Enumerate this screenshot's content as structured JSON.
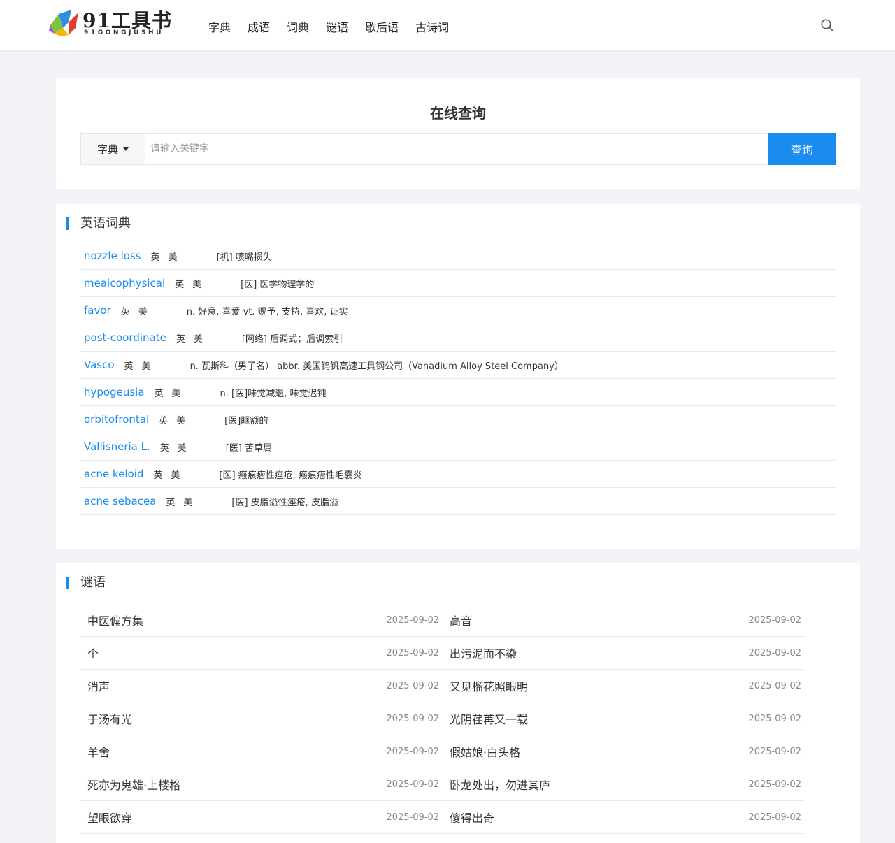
{
  "brand": {
    "logo_text": "91工具书",
    "logo_sub": "91GONGJUSHU"
  },
  "nav": [
    {
      "label": "字典"
    },
    {
      "label": "成语"
    },
    {
      "label": "词典"
    },
    {
      "label": "谜语"
    },
    {
      "label": "歇后语"
    },
    {
      "label": "古诗词"
    }
  ],
  "search": {
    "title": "在线查询",
    "select_value": "字典",
    "placeholder": "请输入关键字",
    "button": "查询"
  },
  "dict": {
    "title": "英语词典",
    "items": [
      {
        "word": "nozzle loss",
        "uk": "英",
        "us": "美",
        "meaning": "[机] 喷嘴损失"
      },
      {
        "word": "meaicophysical",
        "uk": "英",
        "us": "美",
        "meaning": "[医] 医学物理学的"
      },
      {
        "word": "favor",
        "uk": "英",
        "us": "美",
        "meaning": "n. 好意, 喜爱 vt. 赐予, 支持, 喜欢, 证实"
      },
      {
        "word": "post-coordinate",
        "uk": "英",
        "us": "美",
        "meaning": "[网络] 后调式；后调索引"
      },
      {
        "word": "Vasco",
        "uk": "英",
        "us": "美",
        "meaning": "n. 瓦斯科（男子名） abbr. 美国钨钒高速工具钢公司（Vanadium Alloy Steel Company）"
      },
      {
        "word": "hypogeusia",
        "uk": "英",
        "us": "美",
        "meaning": "n. [医]味觉减退, 味觉迟钝"
      },
      {
        "word": "orbitofrontal",
        "uk": "英",
        "us": "美",
        "meaning": "[医]眶额的"
      },
      {
        "word": "Vallisneria L.",
        "uk": "英",
        "us": "美",
        "meaning": "[医] 苦草属"
      },
      {
        "word": "acne keloid",
        "uk": "英",
        "us": "美",
        "meaning": "[医] 瘢痕瘤性痤疮, 瘢痕瘤性毛囊炎"
      },
      {
        "word": "acne sebacea",
        "uk": "英",
        "us": "美",
        "meaning": "[医] 皮脂溢性痤疮, 皮脂溢"
      }
    ]
  },
  "riddles": {
    "title": "谜语",
    "items": [
      {
        "title": "中医偏方集",
        "date": "2025-09-02"
      },
      {
        "title": "高音",
        "date": "2025-09-02"
      },
      {
        "title": "个",
        "date": "2025-09-02"
      },
      {
        "title": "出污泥而不染",
        "date": "2025-09-02"
      },
      {
        "title": "消声",
        "date": "2025-09-02"
      },
      {
        "title": "又见榴花照眼明",
        "date": "2025-09-02"
      },
      {
        "title": "于汤有光",
        "date": "2025-09-02"
      },
      {
        "title": "光阴荏苒又一载",
        "date": "2025-09-02"
      },
      {
        "title": "羊舍",
        "date": "2025-09-02"
      },
      {
        "title": "假姑娘·白头格",
        "date": "2025-09-02"
      },
      {
        "title": "死亦为鬼雄·上楼格",
        "date": "2025-09-02"
      },
      {
        "title": "卧龙处出，勿进其庐",
        "date": "2025-09-02"
      },
      {
        "title": "望眼欲穿",
        "date": "2025-09-02"
      },
      {
        "title": "傻得出奇",
        "date": "2025-09-02"
      }
    ]
  },
  "icons": {
    "search": "search-icon",
    "logo": "logo-mark-icon",
    "caret": "caret-down-icon"
  },
  "colors": {
    "accent": "#1a8cf0",
    "background": "#f1f3f6"
  }
}
